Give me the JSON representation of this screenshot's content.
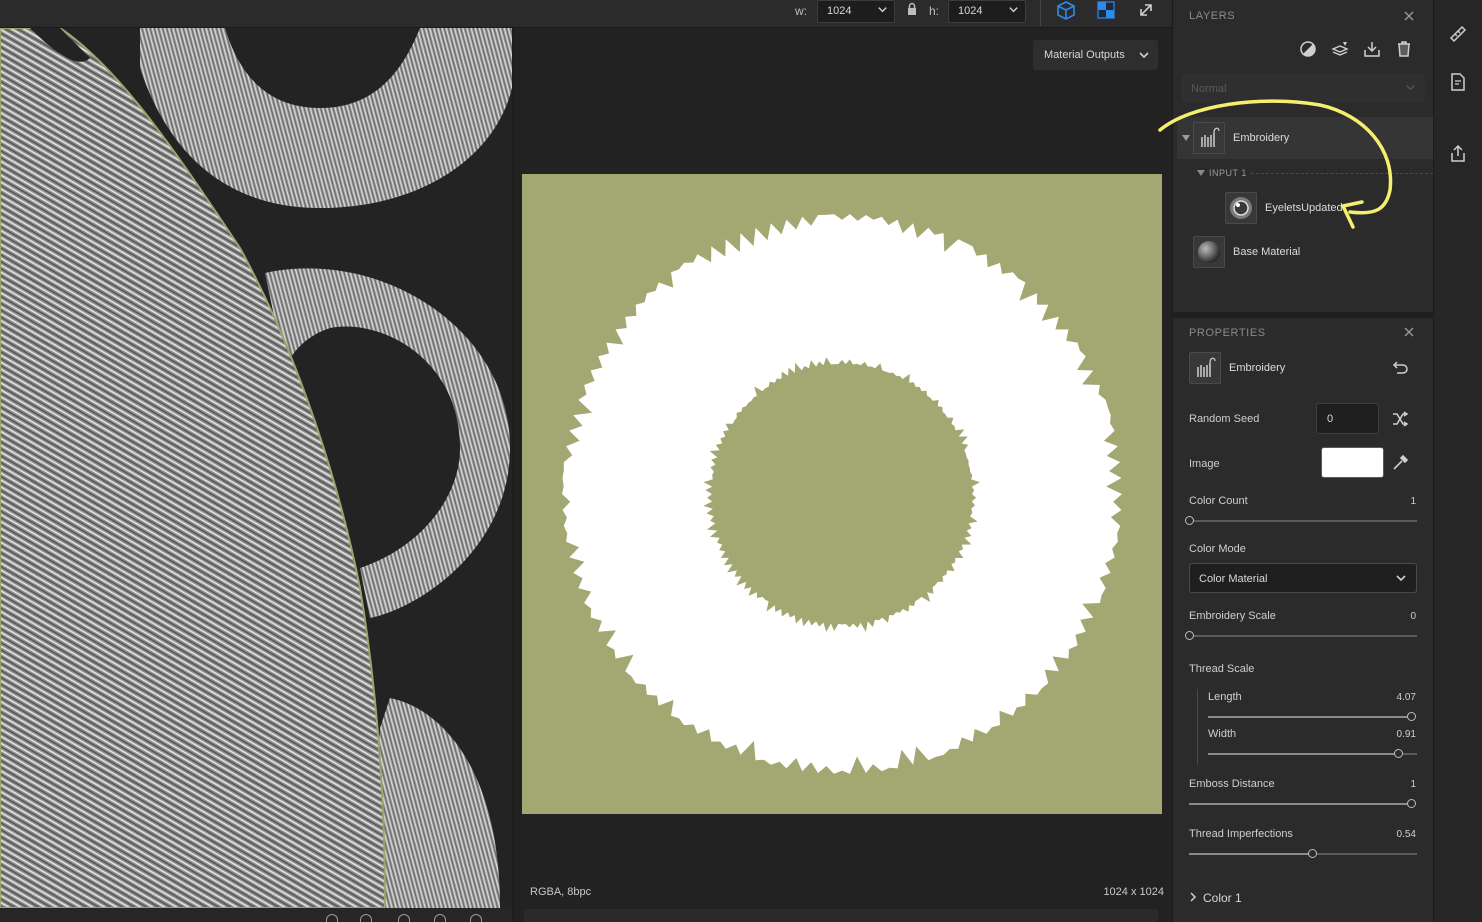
{
  "toolbar": {
    "width_label": "w:",
    "width_value": "1024",
    "height_label": "h:",
    "height_value": "1024",
    "tools": [
      "cube-view-icon",
      "checker-view-icon",
      "expand-icon",
      "lock-icon"
    ]
  },
  "viewport2d": {
    "outputs_button": "Material Outputs",
    "format_info": "RGBA, 8bpc",
    "size_info": "1024 x 1024"
  },
  "layers": {
    "title": "LAYERS",
    "blend_mode": "Normal",
    "items": [
      {
        "name": "Embroidery",
        "icon": "embroidery-icon",
        "selected": true
      },
      {
        "name": "INPUT 1",
        "type": "input-header"
      },
      {
        "name": "EyeletsUpdated",
        "icon": "sphere-icon"
      },
      {
        "name": "Base Material",
        "icon": "sphere-icon"
      }
    ]
  },
  "properties": {
    "title": "PROPERTIES",
    "layer_name": "Embroidery",
    "random_seed": {
      "label": "Random Seed",
      "value": "0"
    },
    "image": {
      "label": "Image",
      "color": "#ffffff"
    },
    "color_count": {
      "label": "Color Count",
      "value": "1",
      "fraction": 0.0
    },
    "color_mode": {
      "label": "Color Mode",
      "value": "Color Material"
    },
    "embroidery_scale": {
      "label": "Embroidery Scale",
      "value": "0",
      "fraction": 0.0
    },
    "thread_scale": {
      "label": "Thread Scale",
      "length": {
        "label": "Length",
        "value": "4.07",
        "fraction": 1.0
      },
      "width": {
        "label": "Width",
        "value": "0.91",
        "fraction": 0.91
      }
    },
    "emboss_distance": {
      "label": "Emboss Distance",
      "value": "1",
      "fraction": 1.0
    },
    "thread_imperfections": {
      "label": "Thread Imperfections",
      "value": "0.54",
      "fraction": 0.54
    },
    "color_section": "Color 1"
  },
  "colors": {
    "canvas_bg": "#a3a872",
    "accent_blue": "#2d8ceb",
    "annotation": "#f4ef6e"
  }
}
